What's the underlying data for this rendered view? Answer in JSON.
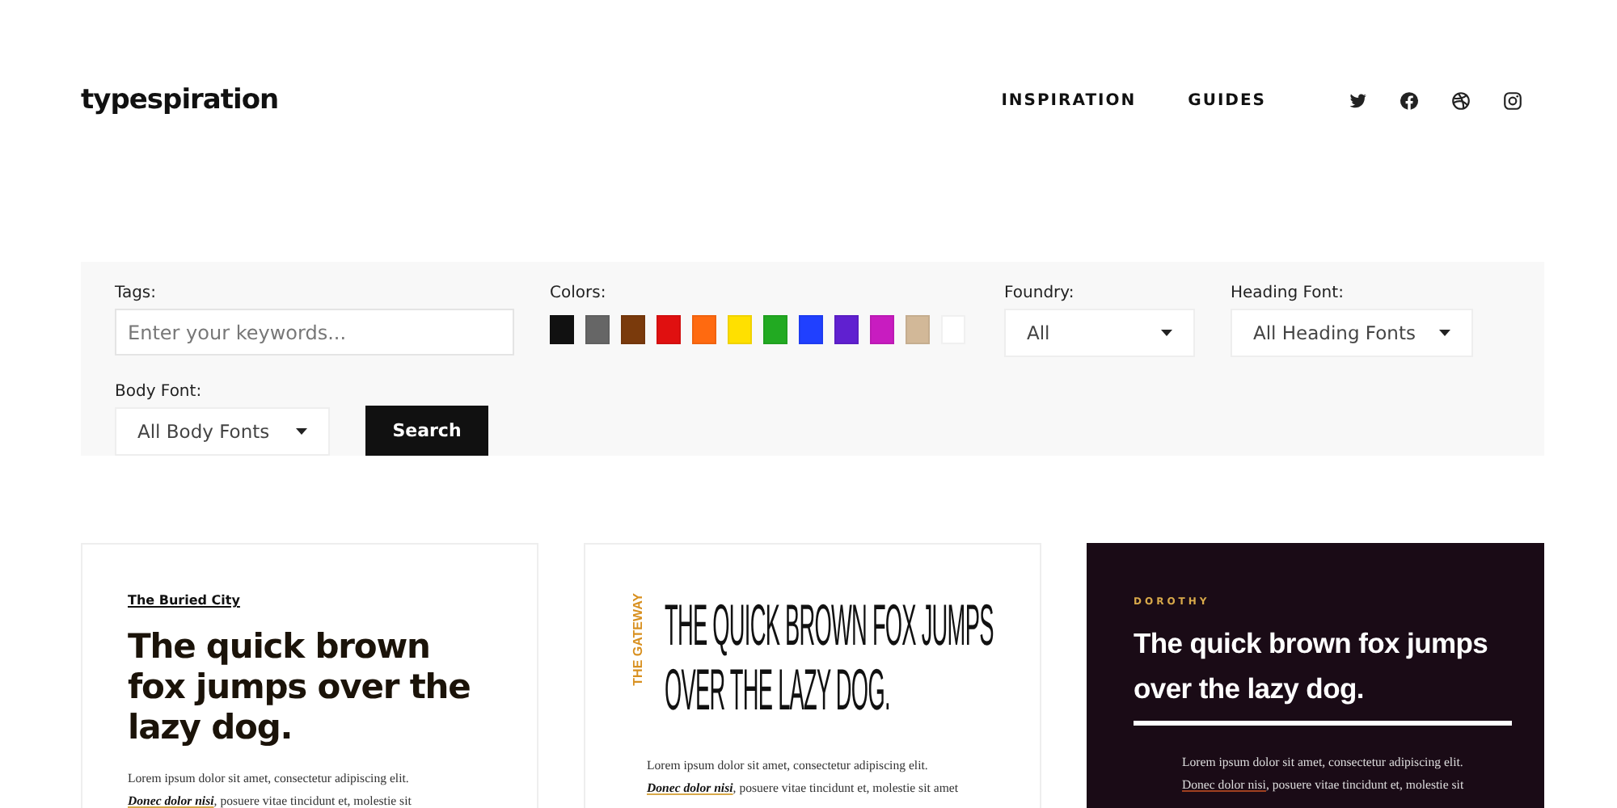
{
  "header": {
    "logo": "typespiration",
    "nav": [
      "INSPIRATION",
      "GUIDES"
    ]
  },
  "filters": {
    "tags": {
      "label": "Tags:",
      "placeholder": "Enter your keywords..."
    },
    "colors_label": "Colors:",
    "colors": [
      {
        "color": "#111111"
      },
      {
        "color": "#666666"
      },
      {
        "color": "#7a3a0c"
      },
      {
        "color": "#e01010"
      },
      {
        "color": "#ff6a10"
      },
      {
        "color": "#ffe000"
      },
      {
        "color": "#22aa22"
      },
      {
        "color": "#2040ff"
      },
      {
        "color": "#6020d0"
      },
      {
        "color": "#c81cc0"
      },
      {
        "color": "#d2b898"
      },
      {
        "color": "#ffffff"
      }
    ],
    "foundry": {
      "label": "Foundry:",
      "value": "All"
    },
    "heading_font": {
      "label": "Heading Font:",
      "value": "All Heading Fonts"
    },
    "body_font": {
      "label": "Body Font:",
      "value": "All Body Fonts"
    },
    "search_button": "Search"
  },
  "cards": [
    {
      "kind": "light",
      "label": "The Buried City",
      "heading": "The quick brown fox jumps over the lazy dog.",
      "intro": "Lorem ipsum dolor sit amet, consectetur adipiscing elit.",
      "link": "Donec dolor nisi",
      "rest": ", posuere vitae tincidunt et, molestie sit"
    },
    {
      "kind": "condensed",
      "label": "THE GATEWAY",
      "heading": "THE QUICK BROWN FOX JUMPS OVER THE LAZY DOG.",
      "intro": "Lorem ipsum dolor sit amet, consectetur adipiscing elit.",
      "link": "Donec dolor nisi",
      "rest": ", posuere vitae tincidunt et, molestie sit amet"
    },
    {
      "kind": "dark",
      "label": "DOROTHY",
      "heading": "The quick brown fox jumps over the lazy dog.",
      "intro": "Lorem ipsum dolor sit amet, consectetur adipiscing elit.",
      "link": "Donec dolor nisi",
      "rest": ", posuere vitae tincidunt et, molestie sit"
    }
  ]
}
